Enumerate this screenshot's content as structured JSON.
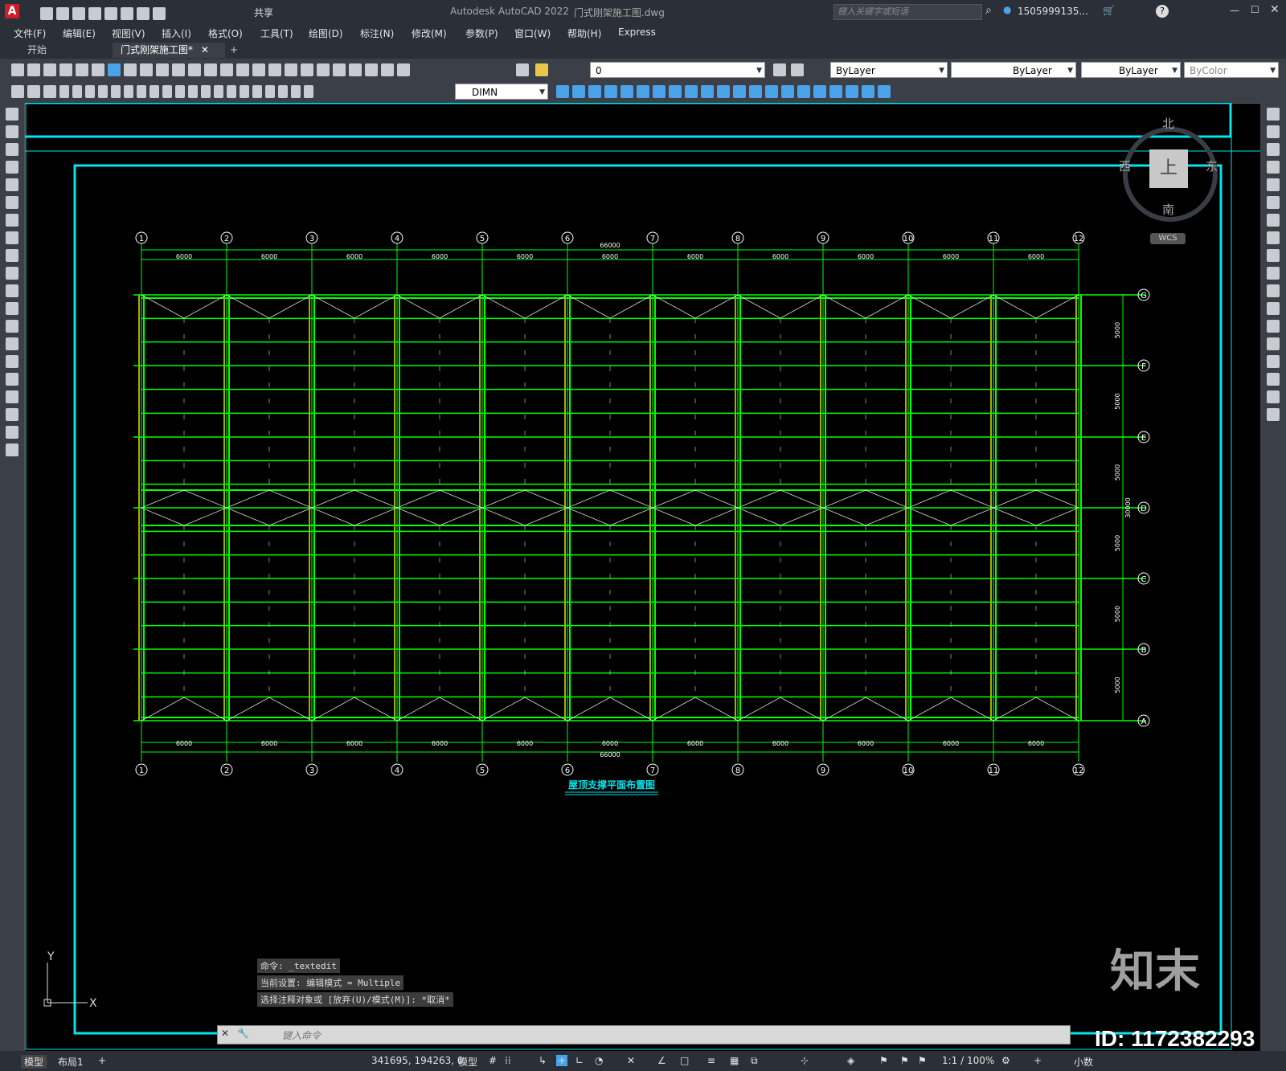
{
  "title": {
    "app": "Autodesk AutoCAD 2022",
    "file": "门式刚架施工图.dwg",
    "share": "共享",
    "search_placeholder": "键入关键字或短语",
    "user": "1505999135..."
  },
  "menu": [
    "文件(F)",
    "编辑(E)",
    "视图(V)",
    "插入(I)",
    "格式(O)",
    "工具(T)",
    "绘图(D)",
    "标注(N)",
    "修改(M)",
    "参数(P)",
    "窗口(W)",
    "帮助(H)",
    "Express"
  ],
  "tabs": {
    "start": "开始",
    "active": "门式刚架施工图*",
    "add": "+"
  },
  "toolbar": {
    "layer": "0",
    "color": "ByLayer",
    "linetype": "ByLayer",
    "lineweight": "ByLayer",
    "plotstyle": "ByColor",
    "dimstyle": "DIMN"
  },
  "viewcube": {
    "north": "北",
    "south": "南",
    "east": "东",
    "west": "西",
    "top": "上",
    "wcs": "WCS"
  },
  "drawing": {
    "columns": [
      "1",
      "2",
      "3",
      "4",
      "5",
      "6",
      "7",
      "8",
      "9",
      "10",
      "11",
      "12"
    ],
    "rows": [
      "G",
      "F",
      "E",
      "D",
      "C",
      "B",
      "A"
    ],
    "bay_dim": "6000",
    "total_dim": "66000",
    "row_dim": "5000",
    "row_total": "30000",
    "title": "屋顶支撑平面布置图"
  },
  "ucs": {
    "y": "Y",
    "x": "X"
  },
  "command": {
    "history": [
      "命令: _textedit",
      "当前设置: 编辑模式 = Multiple",
      "选择注释对象或 [放弃(U)/模式(M)]: *取消*"
    ],
    "placeholder": "键入命令"
  },
  "status": {
    "model_tab": "模型",
    "layout_tab": "布局1",
    "add": "+",
    "coords": "341695, 194263, 0",
    "model": "模型",
    "scale": "1:1 / 100%",
    "units": "小数"
  },
  "watermark": {
    "logo": "知末",
    "id": "ID: 1172382293"
  },
  "colors": {
    "frame": "#00e5ee",
    "grid": "#00ff00",
    "member": "#e6e600",
    "bg": "#000000"
  }
}
